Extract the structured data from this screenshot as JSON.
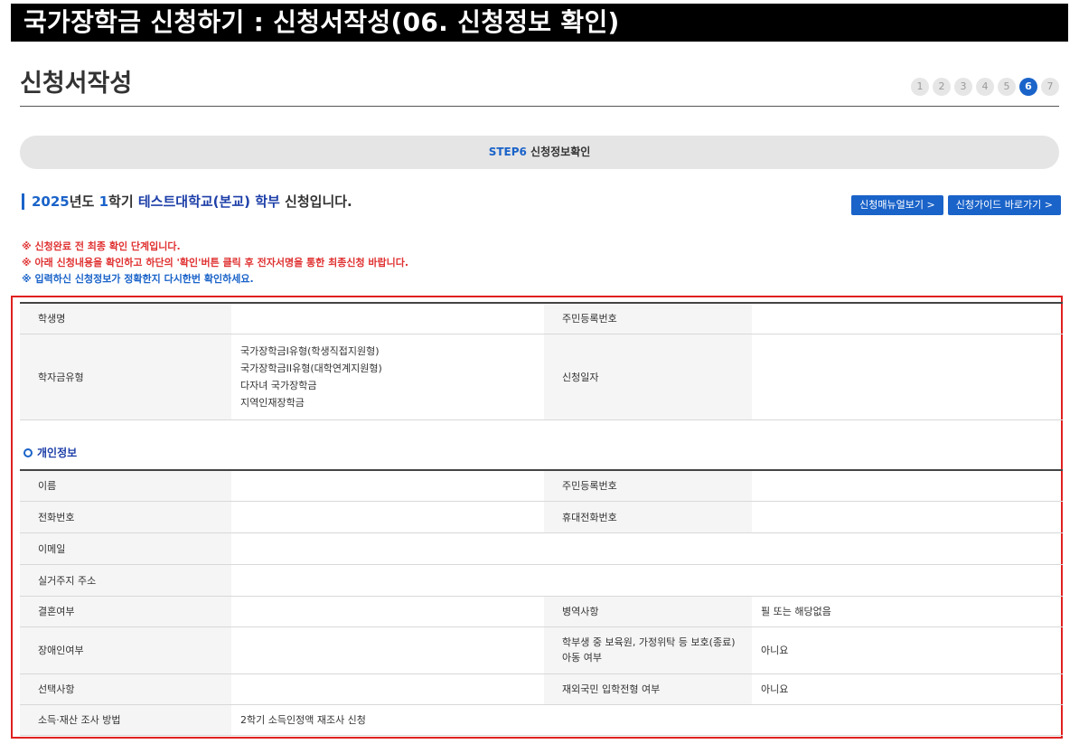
{
  "header": {
    "title": "국가장학금 신청하기 : 신청서작성(06. 신청정보 확인)"
  },
  "page": {
    "title": "신청서작성",
    "steps": [
      "1",
      "2",
      "3",
      "4",
      "5",
      "6",
      "7"
    ],
    "active_step": "6"
  },
  "step_bar": {
    "step": "STEP6",
    "label": "신청정보확인"
  },
  "summary": {
    "year": "2025",
    "year_suffix": "년도",
    "semester": "1",
    "semester_suffix": "학기",
    "school": "테스트대학교(본교) 학부",
    "suffix": "신청입니다."
  },
  "buttons": {
    "manual": "신청매뉴얼보기 >",
    "guide": "신청가이드 바로가기 >"
  },
  "notes": [
    "※ 신청완료 전 최종 확인 단계입니다.",
    "※ 아래 신청내용을 확인하고 하단의 '확인'버튼 클릭 후 전자서명을 통한 최종신청 바랍니다.",
    "※ 입력하신 신청정보가 정확한지 다시한번 확인하세요."
  ],
  "top_table": {
    "student_name_label": "학생명",
    "student_name": "",
    "rrn_label": "주민등록번호",
    "rrn": "",
    "type_label": "학자금유형",
    "types": [
      "국가장학금I유형(학생직접지원형)",
      "국가장학금II유형(대학연계지원형)",
      "다자녀 국가장학금",
      "지역인재장학금"
    ],
    "date_label": "신청일자",
    "date": ""
  },
  "personal": {
    "section_title": "개인정보",
    "name_label": "이름",
    "name": "",
    "rrn_label": "주민등록번호",
    "rrn": "",
    "phone_label": "전화번호",
    "phone": "",
    "mobile_label": "휴대전화번호",
    "mobile": "",
    "email_label": "이메일",
    "email": "",
    "address_label": "실거주지 주소",
    "address": "",
    "married_label": "결혼여부",
    "married": "",
    "military_label": "병역사항",
    "military": "필 또는 해당없음",
    "disabled_label": "장애인여부",
    "disabled": "",
    "foster_label": "학부생 중 보육원, 가정위탁 등 보호(종료)아동 여부",
    "foster": "아니요",
    "optional_label": "선택사항",
    "optional": "",
    "overseas_label": "재외국민 입학전형 여부",
    "overseas": "아니요",
    "income_label": "소득·재산 조사 방법",
    "income": "2학기 소득인정액 재조사 신청"
  }
}
